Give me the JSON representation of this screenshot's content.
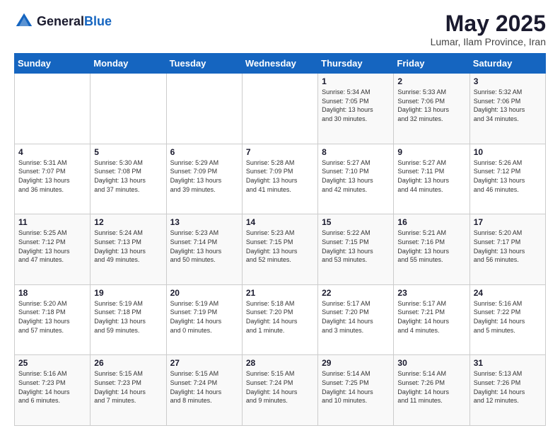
{
  "header": {
    "logo_general": "General",
    "logo_blue": "Blue",
    "month_title": "May 2025",
    "location": "Lumar, Ilam Province, Iran"
  },
  "days_of_week": [
    "Sunday",
    "Monday",
    "Tuesday",
    "Wednesday",
    "Thursday",
    "Friday",
    "Saturday"
  ],
  "weeks": [
    [
      {
        "day": "",
        "info": ""
      },
      {
        "day": "",
        "info": ""
      },
      {
        "day": "",
        "info": ""
      },
      {
        "day": "",
        "info": ""
      },
      {
        "day": "1",
        "info": "Sunrise: 5:34 AM\nSunset: 7:05 PM\nDaylight: 13 hours\nand 30 minutes."
      },
      {
        "day": "2",
        "info": "Sunrise: 5:33 AM\nSunset: 7:06 PM\nDaylight: 13 hours\nand 32 minutes."
      },
      {
        "day": "3",
        "info": "Sunrise: 5:32 AM\nSunset: 7:06 PM\nDaylight: 13 hours\nand 34 minutes."
      }
    ],
    [
      {
        "day": "4",
        "info": "Sunrise: 5:31 AM\nSunset: 7:07 PM\nDaylight: 13 hours\nand 36 minutes."
      },
      {
        "day": "5",
        "info": "Sunrise: 5:30 AM\nSunset: 7:08 PM\nDaylight: 13 hours\nand 37 minutes."
      },
      {
        "day": "6",
        "info": "Sunrise: 5:29 AM\nSunset: 7:09 PM\nDaylight: 13 hours\nand 39 minutes."
      },
      {
        "day": "7",
        "info": "Sunrise: 5:28 AM\nSunset: 7:09 PM\nDaylight: 13 hours\nand 41 minutes."
      },
      {
        "day": "8",
        "info": "Sunrise: 5:27 AM\nSunset: 7:10 PM\nDaylight: 13 hours\nand 42 minutes."
      },
      {
        "day": "9",
        "info": "Sunrise: 5:27 AM\nSunset: 7:11 PM\nDaylight: 13 hours\nand 44 minutes."
      },
      {
        "day": "10",
        "info": "Sunrise: 5:26 AM\nSunset: 7:12 PM\nDaylight: 13 hours\nand 46 minutes."
      }
    ],
    [
      {
        "day": "11",
        "info": "Sunrise: 5:25 AM\nSunset: 7:12 PM\nDaylight: 13 hours\nand 47 minutes."
      },
      {
        "day": "12",
        "info": "Sunrise: 5:24 AM\nSunset: 7:13 PM\nDaylight: 13 hours\nand 49 minutes."
      },
      {
        "day": "13",
        "info": "Sunrise: 5:23 AM\nSunset: 7:14 PM\nDaylight: 13 hours\nand 50 minutes."
      },
      {
        "day": "14",
        "info": "Sunrise: 5:23 AM\nSunset: 7:15 PM\nDaylight: 13 hours\nand 52 minutes."
      },
      {
        "day": "15",
        "info": "Sunrise: 5:22 AM\nSunset: 7:15 PM\nDaylight: 13 hours\nand 53 minutes."
      },
      {
        "day": "16",
        "info": "Sunrise: 5:21 AM\nSunset: 7:16 PM\nDaylight: 13 hours\nand 55 minutes."
      },
      {
        "day": "17",
        "info": "Sunrise: 5:20 AM\nSunset: 7:17 PM\nDaylight: 13 hours\nand 56 minutes."
      }
    ],
    [
      {
        "day": "18",
        "info": "Sunrise: 5:20 AM\nSunset: 7:18 PM\nDaylight: 13 hours\nand 57 minutes."
      },
      {
        "day": "19",
        "info": "Sunrise: 5:19 AM\nSunset: 7:18 PM\nDaylight: 13 hours\nand 59 minutes."
      },
      {
        "day": "20",
        "info": "Sunrise: 5:19 AM\nSunset: 7:19 PM\nDaylight: 14 hours\nand 0 minutes."
      },
      {
        "day": "21",
        "info": "Sunrise: 5:18 AM\nSunset: 7:20 PM\nDaylight: 14 hours\nand 1 minute."
      },
      {
        "day": "22",
        "info": "Sunrise: 5:17 AM\nSunset: 7:20 PM\nDaylight: 14 hours\nand 3 minutes."
      },
      {
        "day": "23",
        "info": "Sunrise: 5:17 AM\nSunset: 7:21 PM\nDaylight: 14 hours\nand 4 minutes."
      },
      {
        "day": "24",
        "info": "Sunrise: 5:16 AM\nSunset: 7:22 PM\nDaylight: 14 hours\nand 5 minutes."
      }
    ],
    [
      {
        "day": "25",
        "info": "Sunrise: 5:16 AM\nSunset: 7:23 PM\nDaylight: 14 hours\nand 6 minutes."
      },
      {
        "day": "26",
        "info": "Sunrise: 5:15 AM\nSunset: 7:23 PM\nDaylight: 14 hours\nand 7 minutes."
      },
      {
        "day": "27",
        "info": "Sunrise: 5:15 AM\nSunset: 7:24 PM\nDaylight: 14 hours\nand 8 minutes."
      },
      {
        "day": "28",
        "info": "Sunrise: 5:15 AM\nSunset: 7:24 PM\nDaylight: 14 hours\nand 9 minutes."
      },
      {
        "day": "29",
        "info": "Sunrise: 5:14 AM\nSunset: 7:25 PM\nDaylight: 14 hours\nand 10 minutes."
      },
      {
        "day": "30",
        "info": "Sunrise: 5:14 AM\nSunset: 7:26 PM\nDaylight: 14 hours\nand 11 minutes."
      },
      {
        "day": "31",
        "info": "Sunrise: 5:13 AM\nSunset: 7:26 PM\nDaylight: 14 hours\nand 12 minutes."
      }
    ]
  ]
}
